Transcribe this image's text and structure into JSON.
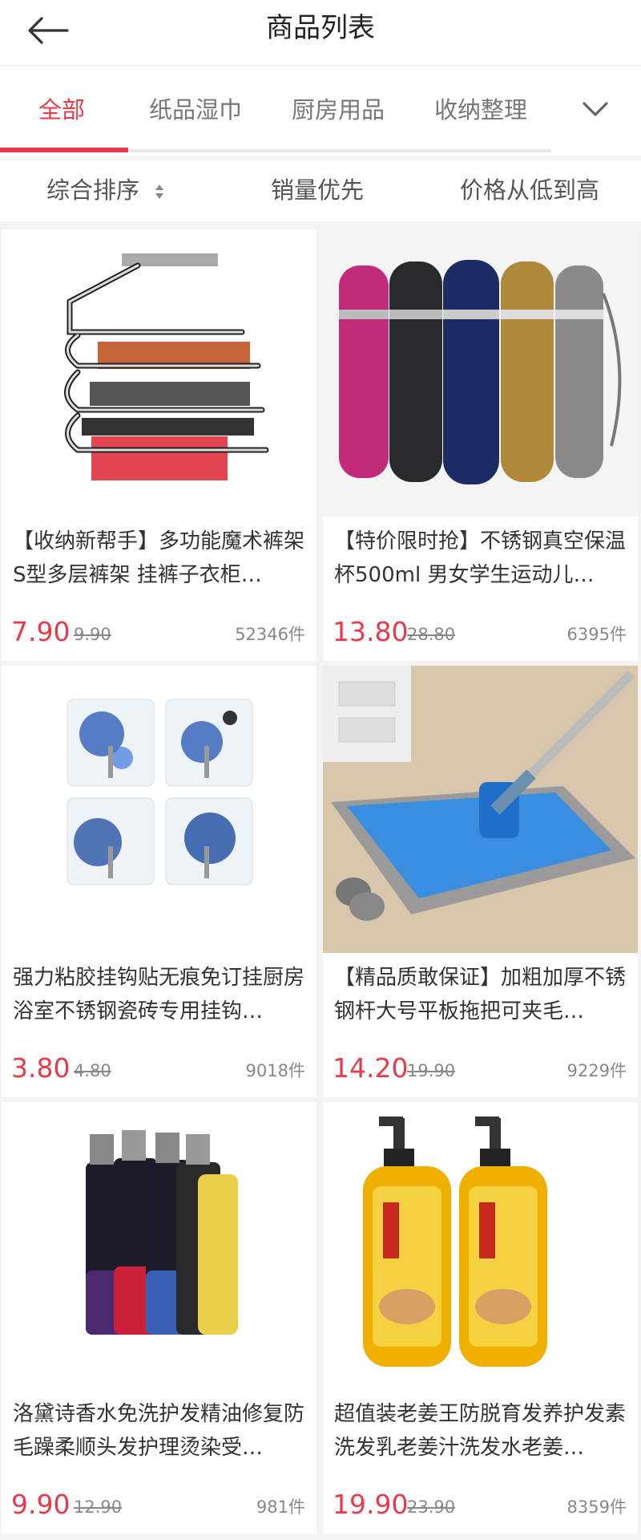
{
  "header": {
    "title": "商品列表",
    "back_icon": "arrow-left-icon"
  },
  "tabs": {
    "items": [
      "全部",
      "纸品湿巾",
      "厨房用品",
      "收纳整理"
    ],
    "active_index": 0,
    "more_icon": "chevron-down-icon"
  },
  "sort": {
    "items": [
      "综合排序",
      "销量优先",
      "价格从低到高"
    ],
    "sort_icon": "sort-arrows-icon"
  },
  "colors": {
    "accent": "#e83a4a",
    "muted": "#888888"
  },
  "products": [
    {
      "name": "【收纳新帮手】多功能魔术裤架S型多层裤架 挂裤子衣柜…",
      "price": "7.90",
      "original_price": "9.90",
      "sales": "52346件",
      "image": "pants-hanger"
    },
    {
      "name": "【特价限时抢】不锈钢真空保温杯500ml 男女学生运动儿…",
      "price": "13.80",
      "original_price": "28.80",
      "sales": "6395件",
      "image": "thermos-bottles"
    },
    {
      "name": "强力粘胶挂钩贴无痕免订挂厨房浴室不锈钢瓷砖专用挂钩…",
      "price": "3.80",
      "original_price": "4.80",
      "sales": "9018件",
      "image": "porcelain-hooks"
    },
    {
      "name": "【精品质敢保证】加粗加厚不锈钢杆大号平板拖把可夹毛…",
      "price": "14.20",
      "original_price": "19.90",
      "sales": "9229件",
      "image": "flat-mop"
    },
    {
      "name": "洛黛诗香水免洗护发精油修复防毛躁柔顺头发护理烫染受…",
      "price": "9.90",
      "original_price": "12.90",
      "sales": "981件",
      "image": "hair-oil-bottles"
    },
    {
      "name": "超值装老姜王防脱育发养护发素洗发乳老姜汁洗发水老姜…",
      "price": "19.90",
      "original_price": "23.90",
      "sales": "8359件",
      "image": "ginger-shampoo"
    }
  ]
}
